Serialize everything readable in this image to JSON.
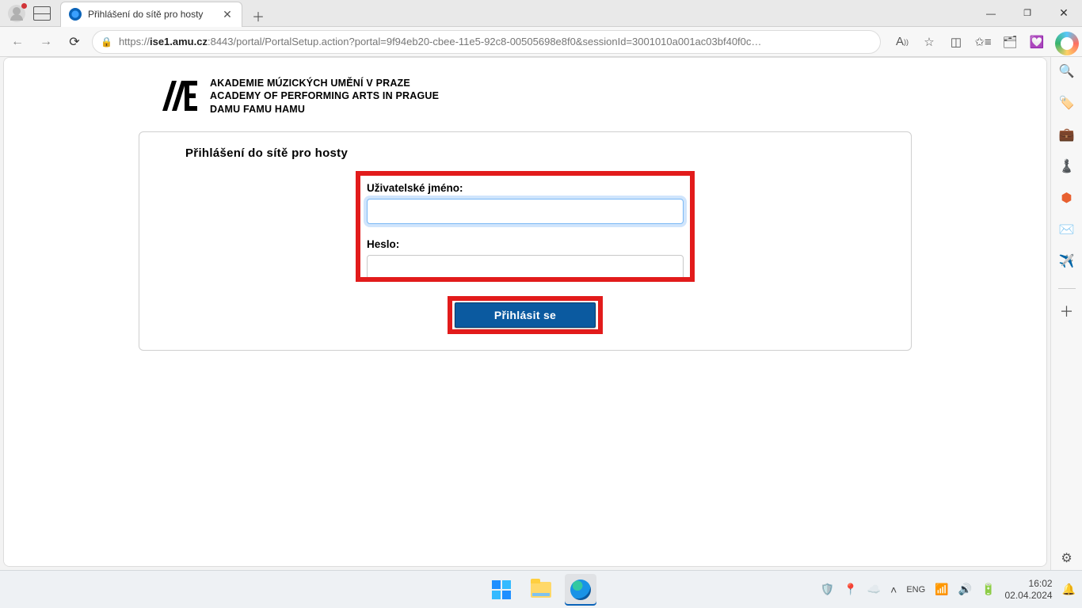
{
  "browser": {
    "tab_title": "Přihlášení do sítě pro hosty",
    "url_display_prefix": "https://",
    "url_host": "ise1.amu.cz",
    "url_rest": ":8443/portal/PortalSetup.action?portal=9f94eb20-cbee-11e5-92c8-00505698e8f0&sessionId=3001010a001ac03bf40f0c…"
  },
  "page": {
    "logo_line1": "AKADEMIE MÚZICKÝCH UMĚNÍ V PRAZE",
    "logo_line2": "ACADEMY OF PERFORMING ARTS IN PRAGUE",
    "logo_line3": "DAMU FAMU HAMU",
    "panel_title": "Přihlášení do sítě pro hosty",
    "username_label": "Uživatelské jméno:",
    "username_value": "",
    "password_label": "Heslo:",
    "password_value": "",
    "submit_label": "Přihlásit se"
  },
  "system": {
    "time": "16:02",
    "date": "02.04.2024"
  }
}
